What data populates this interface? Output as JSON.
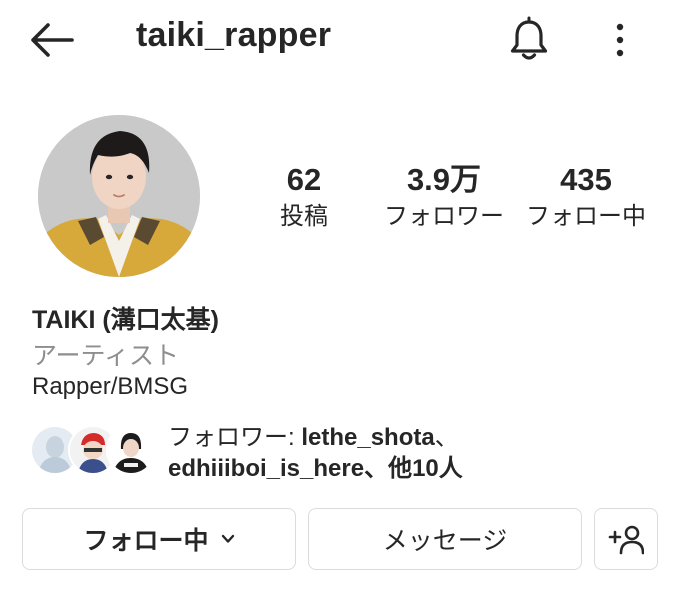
{
  "header": {
    "username": "taiki_rapper",
    "icons": [
      "back-arrow-icon",
      "bell-icon",
      "more-vertical-icon"
    ]
  },
  "stats": {
    "posts": {
      "value": "62",
      "label": "投稿"
    },
    "followers": {
      "value": "3.9万",
      "label": "フォロワー"
    },
    "following": {
      "value": "435",
      "label": "フォロー中"
    }
  },
  "bio": {
    "name": "TAIKI (溝口太基)",
    "category": "アーティスト",
    "text": "Rapper/BMSG"
  },
  "followed_by": {
    "prefix": "フォロワー: ",
    "user1": "lethe_shota",
    "sep1": "、",
    "user2": "edhiiiboi_is_here",
    "suffix": "、他10人"
  },
  "buttons": {
    "follow": "フォロー中",
    "message": "メッセージ",
    "add_user_icon": "add-user-icon"
  }
}
